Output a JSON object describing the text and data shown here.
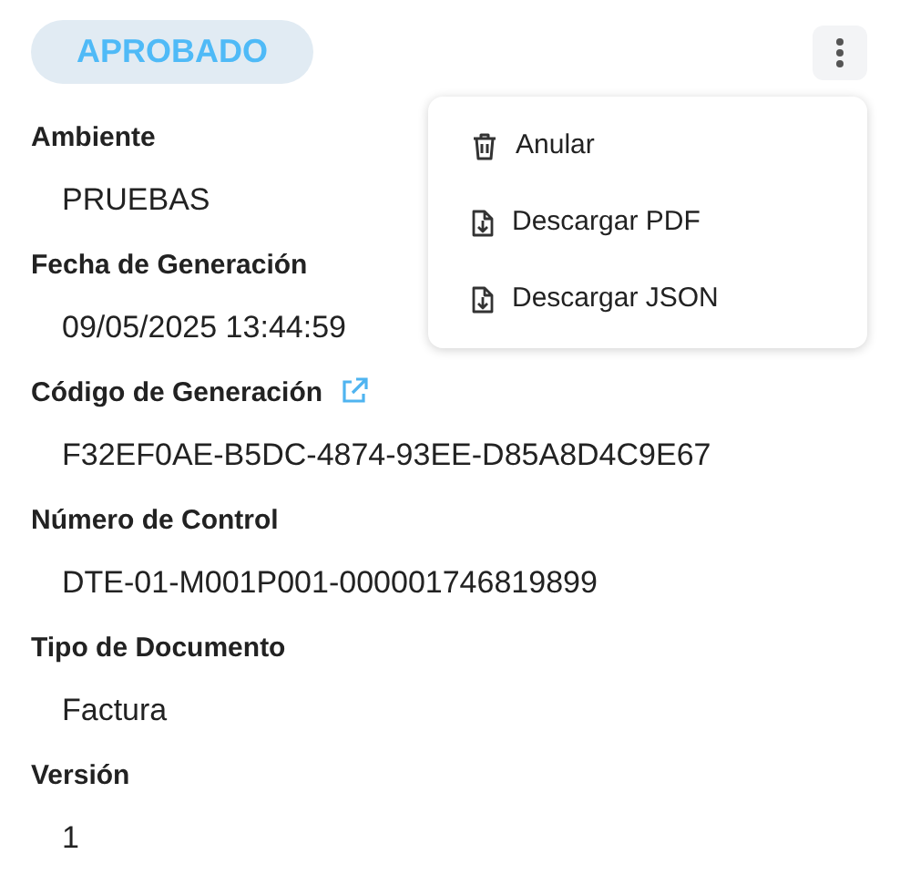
{
  "status": {
    "label": "APROBADO"
  },
  "menu": {
    "open": true,
    "items": [
      {
        "label": "Anular",
        "kind": "delete"
      },
      {
        "label": "Descargar PDF",
        "kind": "download"
      },
      {
        "label": "Descargar JSON",
        "kind": "download"
      }
    ]
  },
  "fields": [
    {
      "label": "Ambiente",
      "value": "PRUEBAS",
      "has_link": false
    },
    {
      "label": "Fecha de Generación",
      "value": "09/05/2025 13:44:59",
      "has_link": false
    },
    {
      "label": "Código de Generación",
      "value": "F32EF0AE-B5DC-4874-93EE-D85A8D4C9E67",
      "has_link": true
    },
    {
      "label": "Número de Control",
      "value": "DTE-01-M001P001-000001746819899",
      "has_link": false
    },
    {
      "label": "Tipo de Documento",
      "value": "Factura",
      "has_link": false
    },
    {
      "label": "Versión",
      "value": "1",
      "has_link": false
    }
  ]
}
